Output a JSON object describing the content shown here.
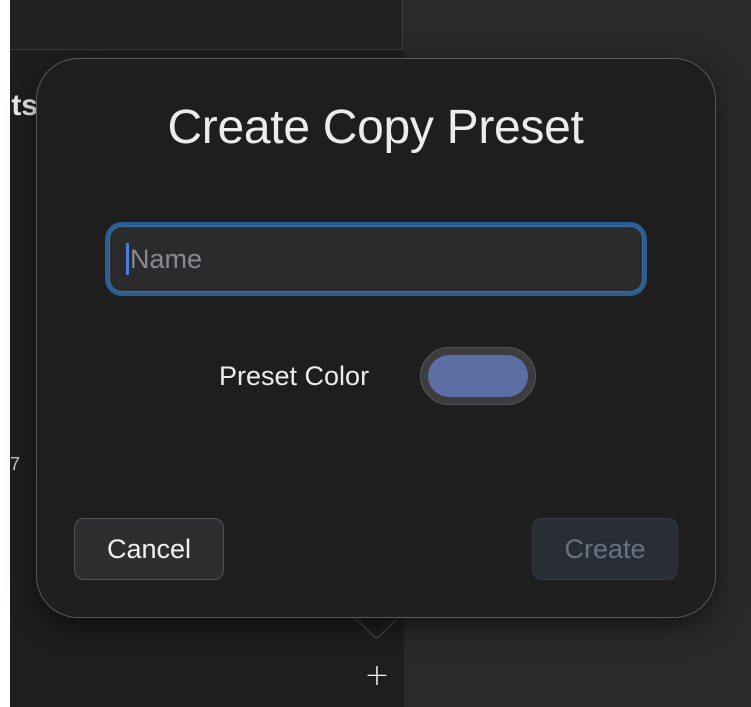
{
  "background": {
    "heading_fragment": "ts",
    "row_fragment": "7",
    "add_button_label": "+"
  },
  "dialog": {
    "title": "Create Copy Preset",
    "name_field": {
      "value": "",
      "placeholder": "Name"
    },
    "preset_color": {
      "label": "Preset Color",
      "value": "#5c6ea3"
    },
    "buttons": {
      "cancel": "Cancel",
      "create": "Create"
    },
    "create_enabled": false
  },
  "colors": {
    "accent_focus": "#2b5e93",
    "swatch": "#5c6ea3",
    "dialog_bg": "#1e1e1f"
  }
}
